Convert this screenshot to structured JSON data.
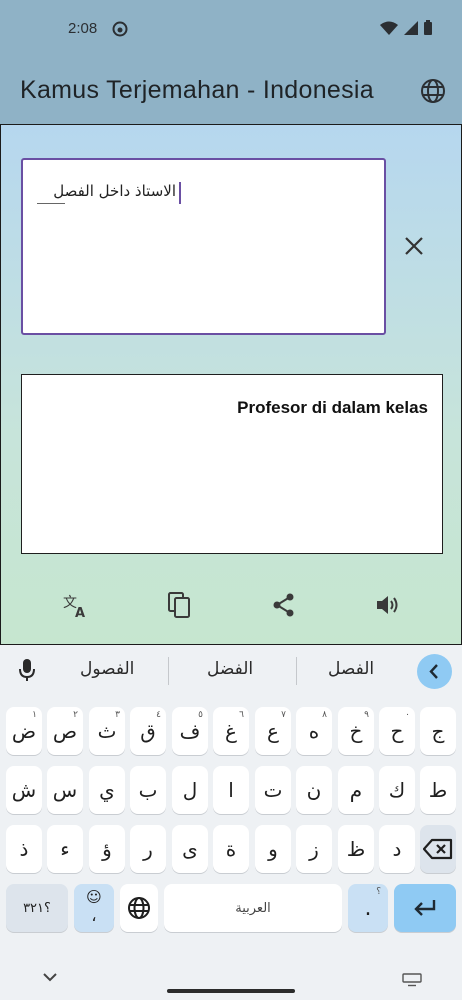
{
  "status": {
    "time": "2:08"
  },
  "appbar": {
    "title": "Kamus Terjemahan - Indonesia"
  },
  "input": {
    "text": "الاستاذ داخل الفصل"
  },
  "output": {
    "text": "Profesor di dalam kelas"
  },
  "keyboard": {
    "suggestions": [
      "الفصول",
      "الفضل",
      "الفصل"
    ],
    "row1": [
      {
        "k": "ض",
        "s": "١"
      },
      {
        "k": "ص",
        "s": "٢"
      },
      {
        "k": "ث",
        "s": "٣"
      },
      {
        "k": "ق",
        "s": "٤"
      },
      {
        "k": "ف",
        "s": "٥"
      },
      {
        "k": "غ",
        "s": "٦"
      },
      {
        "k": "ع",
        "s": "٧"
      },
      {
        "k": "ه",
        "s": "٨"
      },
      {
        "k": "خ",
        "s": "٩"
      },
      {
        "k": "ح",
        "s": "٠"
      },
      {
        "k": "ج",
        "s": ""
      }
    ],
    "row2": [
      "ش",
      "س",
      "ي",
      "ب",
      "ل",
      "ا",
      "ت",
      "ن",
      "م",
      "ك",
      "ط"
    ],
    "row3": [
      "ذ",
      "ء",
      "ؤ",
      "ر",
      "ى",
      "ة",
      "و",
      "ز",
      "ظ",
      "د"
    ],
    "symbols_label": "؟٣٢١",
    "emoji_comma": "،",
    "space_label": "العربية",
    "period_label": ".",
    "period_sup": "؟"
  },
  "colors": {
    "accent": "#6a4fa3",
    "appbar": "#8fb2c6",
    "enter": "#8fcaf3"
  }
}
